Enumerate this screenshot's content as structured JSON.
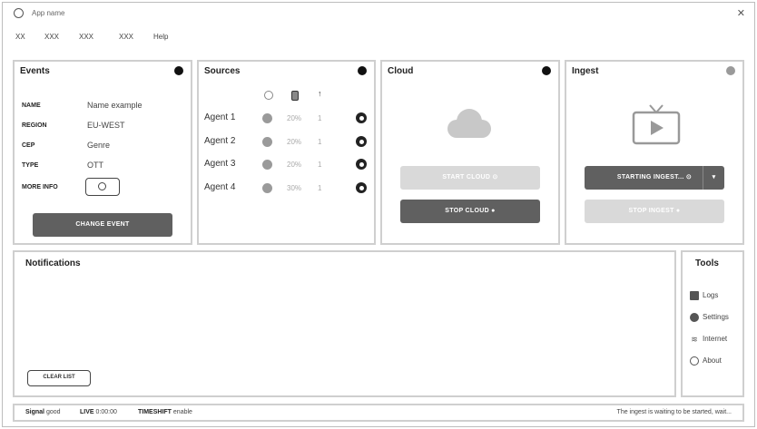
{
  "window": {
    "title": "App name"
  },
  "menu": {
    "items": [
      "XX",
      "XXX",
      "XXX",
      "XXX",
      "Help"
    ]
  },
  "events": {
    "title": "Events",
    "rows": [
      {
        "key": "NAME",
        "value": "Name example"
      },
      {
        "key": "REGION",
        "value": "EU-WEST"
      },
      {
        "key": "CEP",
        "value": "Genre"
      },
      {
        "key": "TYPE",
        "value": "OTT"
      },
      {
        "key": "MORE INFO",
        "value": ""
      }
    ],
    "change_button": "CHANGE EVENT"
  },
  "sources": {
    "title": "Sources",
    "agents": [
      {
        "name": "Agent 1",
        "pct": "20%",
        "count": "1"
      },
      {
        "name": "Agent 2",
        "pct": "20%",
        "count": "1"
      },
      {
        "name": "Agent 3",
        "pct": "20%",
        "count": "1"
      },
      {
        "name": "Agent 4",
        "pct": "30%",
        "count": "1"
      }
    ]
  },
  "cloud": {
    "title": "Cloud",
    "start_button": "START CLOUD",
    "stop_button": "STOP CLOUD"
  },
  "ingest": {
    "title": "Ingest",
    "starting_button": "STARTING INGEST...",
    "stop_button": "STOP INGEST"
  },
  "notifications": {
    "title": "Notifications",
    "clear_button": "CLEAR LIST"
  },
  "tools": {
    "title": "Tools",
    "items": [
      {
        "label": "Logs",
        "icon": "logs-icon"
      },
      {
        "label": "Settings",
        "icon": "settings-icon"
      },
      {
        "label": "Internet",
        "icon": "wifi-icon"
      },
      {
        "label": "About",
        "icon": "info-icon"
      }
    ]
  },
  "status": {
    "signal_label": "Signal",
    "signal_value": "good",
    "live_label": "LIVE",
    "live_value": "0:00:00",
    "timeshift_label": "TIMESHIFT",
    "timeshift_value": "enable",
    "message": "The ingest is waiting to be started, wait..."
  }
}
